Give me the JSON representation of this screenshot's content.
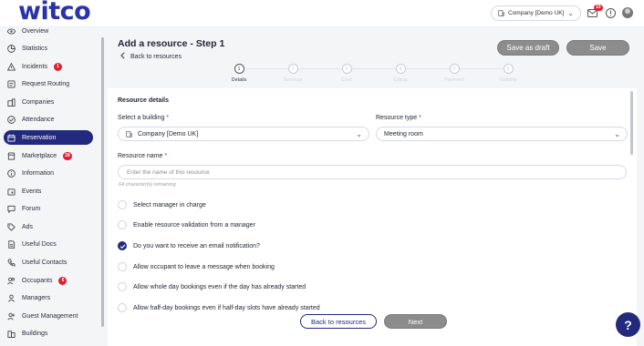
{
  "header": {
    "logo": "witco",
    "company_selector": "Company [Demo UK]",
    "mail_badge": "19"
  },
  "sidebar": {
    "items": [
      {
        "label": "Overview",
        "icon": "eye-icon",
        "badge": ""
      },
      {
        "label": "Statistics",
        "icon": "pie-chart-icon",
        "badge": ""
      },
      {
        "label": "Incidents",
        "icon": "warning-icon",
        "badge": "1"
      },
      {
        "label": "Request Routing",
        "icon": "routing-icon",
        "badge": ""
      },
      {
        "label": "Companies",
        "icon": "building-icon",
        "badge": ""
      },
      {
        "label": "Attendance",
        "icon": "check-circle-icon",
        "badge": ""
      },
      {
        "label": "Reservation",
        "icon": "calendar-icon",
        "badge": ""
      },
      {
        "label": "Marketplace",
        "icon": "shop-icon",
        "badge": "28"
      },
      {
        "label": "Information",
        "icon": "info-icon",
        "badge": ""
      },
      {
        "label": "Events",
        "icon": "event-icon",
        "badge": ""
      },
      {
        "label": "Forum",
        "icon": "chat-icon",
        "badge": ""
      },
      {
        "label": "Ads",
        "icon": "tag-icon",
        "badge": ""
      },
      {
        "label": "Useful Docs",
        "icon": "document-icon",
        "badge": ""
      },
      {
        "label": "Useful Contacts",
        "icon": "phone-icon",
        "badge": ""
      },
      {
        "label": "Occupants",
        "icon": "users-icon",
        "badge": "6"
      },
      {
        "label": "Managers",
        "icon": "user-icon",
        "badge": ""
      },
      {
        "label": "Guest Management",
        "icon": "guest-icon",
        "badge": ""
      },
      {
        "label": "Buildings",
        "icon": "buildings-icon",
        "badge": ""
      }
    ],
    "active": "Reservation"
  },
  "page": {
    "title": "Add a resource - Step 1",
    "back_link": "Back to resources",
    "save_draft": "Save as draft",
    "save": "Save"
  },
  "stepper": {
    "steps": [
      {
        "number": "1",
        "label": "Details"
      },
      {
        "number": "2",
        "label": "Services"
      },
      {
        "number": "3",
        "label": "Cost"
      },
      {
        "number": "4",
        "label": "Extras"
      },
      {
        "number": "5",
        "label": "Payment"
      },
      {
        "number": "6",
        "label": "Visibility"
      }
    ],
    "current": "1"
  },
  "form": {
    "section_title": "Resource details",
    "building_label": "Select a building",
    "building_value": "Company [Demo UK]",
    "type_label": "Resource type",
    "type_value": "Meeting room",
    "name_label": "Resource name",
    "name_placeholder": "Enter the name of this resource",
    "name_value": "",
    "name_hint": "64 character(s) remaining",
    "options": [
      {
        "label": "Select manager in charge",
        "checked": false
      },
      {
        "label": "Enable resource validation from a manager",
        "checked": false
      },
      {
        "label": "Do you want to receive an email notification?",
        "checked": true
      },
      {
        "label": "Allow occupant to leave a message when booking",
        "checked": false
      },
      {
        "label": "Allow whole day bookings even if the day has already started",
        "checked": false
      },
      {
        "label": "Allow half-day bookings even if half-day slots have already started",
        "checked": false
      }
    ]
  },
  "footer": {
    "back_button": "Back to resources",
    "next_button": "Next"
  },
  "help_label": "?",
  "colors": {
    "brand": "#232a7d",
    "logo": "#2a33a8",
    "badge": "#e0202f",
    "button_gray": "#8c8c8c"
  }
}
